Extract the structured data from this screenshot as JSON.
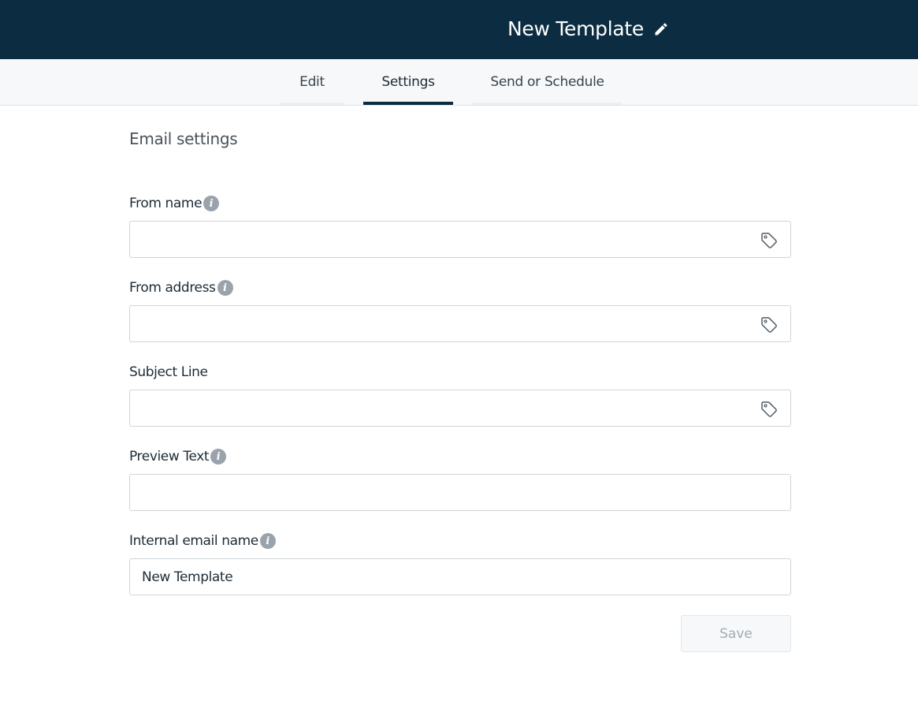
{
  "header": {
    "title": "New Template",
    "edit_icon": "pencil-icon",
    "background_color": "#0c2d41"
  },
  "tabs": [
    {
      "label": "Edit",
      "active": false
    },
    {
      "label": "Settings",
      "active": true
    },
    {
      "label": "Send or Schedule",
      "active": false
    }
  ],
  "section": {
    "title": "Email settings"
  },
  "fields": {
    "from_name": {
      "label": "From name",
      "value": "",
      "info_icon": "info-icon",
      "tag_icon": "tag-icon"
    },
    "from_address": {
      "label": "From address",
      "value": "",
      "info_icon": "info-icon",
      "tag_icon": "tag-icon"
    },
    "subject_line": {
      "label": "Subject Line",
      "value": "",
      "tag_icon": "tag-icon"
    },
    "preview_text": {
      "label": "Preview Text",
      "value": "",
      "info_icon": "info-icon"
    },
    "internal_email_name": {
      "label": "Internal email name",
      "value": "New Template",
      "info_icon": "info-icon"
    }
  },
  "actions": {
    "save_label": "Save",
    "save_disabled": true
  }
}
